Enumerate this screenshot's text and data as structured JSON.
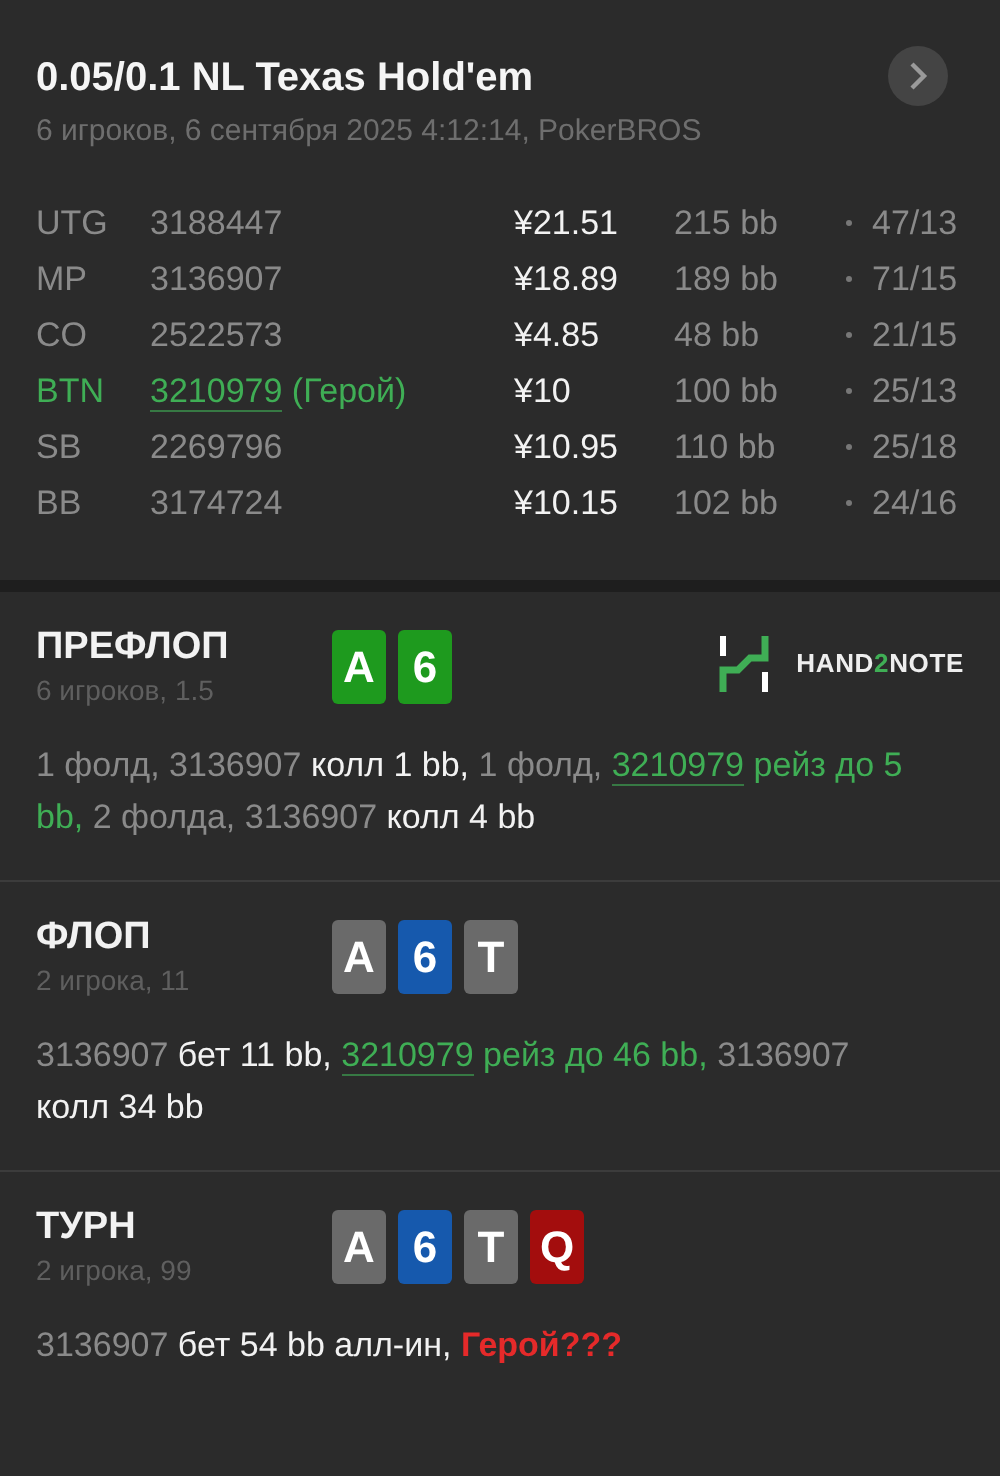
{
  "header": {
    "title": "0.05/0.1 NL Texas Hold'em",
    "subtitle": "6 игроков, 6 сентября 2025 4:12:14, PokerBROS"
  },
  "players": [
    {
      "position": "UTG",
      "id": "3188447",
      "hero": false,
      "stack": "¥21.51",
      "bb": "215 bb",
      "stats": "47/13"
    },
    {
      "position": "MP",
      "id": "3136907",
      "hero": false,
      "stack": "¥18.89",
      "bb": "189 bb",
      "stats": "71/15"
    },
    {
      "position": "CO",
      "id": "2522573",
      "hero": false,
      "stack": "¥4.85",
      "bb": "48 bb",
      "stats": "21/15"
    },
    {
      "position": "BTN",
      "id": "3210979",
      "hero": true,
      "hero_label": "(Герой)",
      "stack": "¥10",
      "bb": "100 bb",
      "stats": "25/13"
    },
    {
      "position": "SB",
      "id": "2269796",
      "hero": false,
      "stack": "¥10.95",
      "bb": "110 bb",
      "stats": "25/18"
    },
    {
      "position": "BB",
      "id": "3174724",
      "hero": false,
      "stack": "¥10.15",
      "bb": "102 bb",
      "stats": "24/16"
    }
  ],
  "streets": [
    {
      "name": "ПРЕФЛОП",
      "info": "6 игроков, 1.5",
      "cards": [
        {
          "rank": "A",
          "color": "#1e9a1e"
        },
        {
          "rank": "6",
          "color": "#1e9a1e"
        }
      ],
      "logo": {
        "parts": [
          {
            "text": "HAND",
            "accent": false
          },
          {
            "text": "2",
            "accent": true
          },
          {
            "text": "NOTE",
            "accent": false
          }
        ]
      },
      "actions": [
        {
          "kind": "player",
          "text": "1 фолд, 3136907"
        },
        {
          "kind": "action",
          "text": "колл 1 bb,"
        },
        {
          "kind": "player",
          "text": "1 фолд,"
        },
        {
          "kind": "hero",
          "text": "3210979"
        },
        {
          "kind": "hero_action",
          "text": "рейз до 5 bb,"
        },
        {
          "kind": "player",
          "text": "2 фолда, 3136907"
        },
        {
          "kind": "action",
          "text": "колл 4 bb"
        }
      ]
    },
    {
      "name": "ФЛОП",
      "info": "2 игрока, 11",
      "cards": [
        {
          "rank": "A",
          "color": "#6a6a6a"
        },
        {
          "rank": "6",
          "color": "#1659ad"
        },
        {
          "rank": "T",
          "color": "#6a6a6a"
        }
      ],
      "actions": [
        {
          "kind": "player",
          "text": "3136907"
        },
        {
          "kind": "action",
          "text": "бет 11 bb,"
        },
        {
          "kind": "hero",
          "text": "3210979"
        },
        {
          "kind": "hero_action",
          "text": "рейз до 46 bb,"
        },
        {
          "kind": "player",
          "text": "3136907"
        },
        {
          "kind": "action",
          "text": "колл 34 bb"
        }
      ]
    },
    {
      "name": "ТУРН",
      "info": "2 игрока, 99",
      "cards": [
        {
          "rank": "A",
          "color": "#6a6a6a"
        },
        {
          "rank": "6",
          "color": "#1659ad"
        },
        {
          "rank": "T",
          "color": "#6a6a6a"
        },
        {
          "rank": "Q",
          "color": "#a30d0d"
        }
      ],
      "actions": [
        {
          "kind": "player",
          "text": "3136907"
        },
        {
          "kind": "action",
          "text": "бет 54 bb алл-ин,"
        },
        {
          "kind": "question",
          "text": "Герой???"
        }
      ]
    }
  ]
}
